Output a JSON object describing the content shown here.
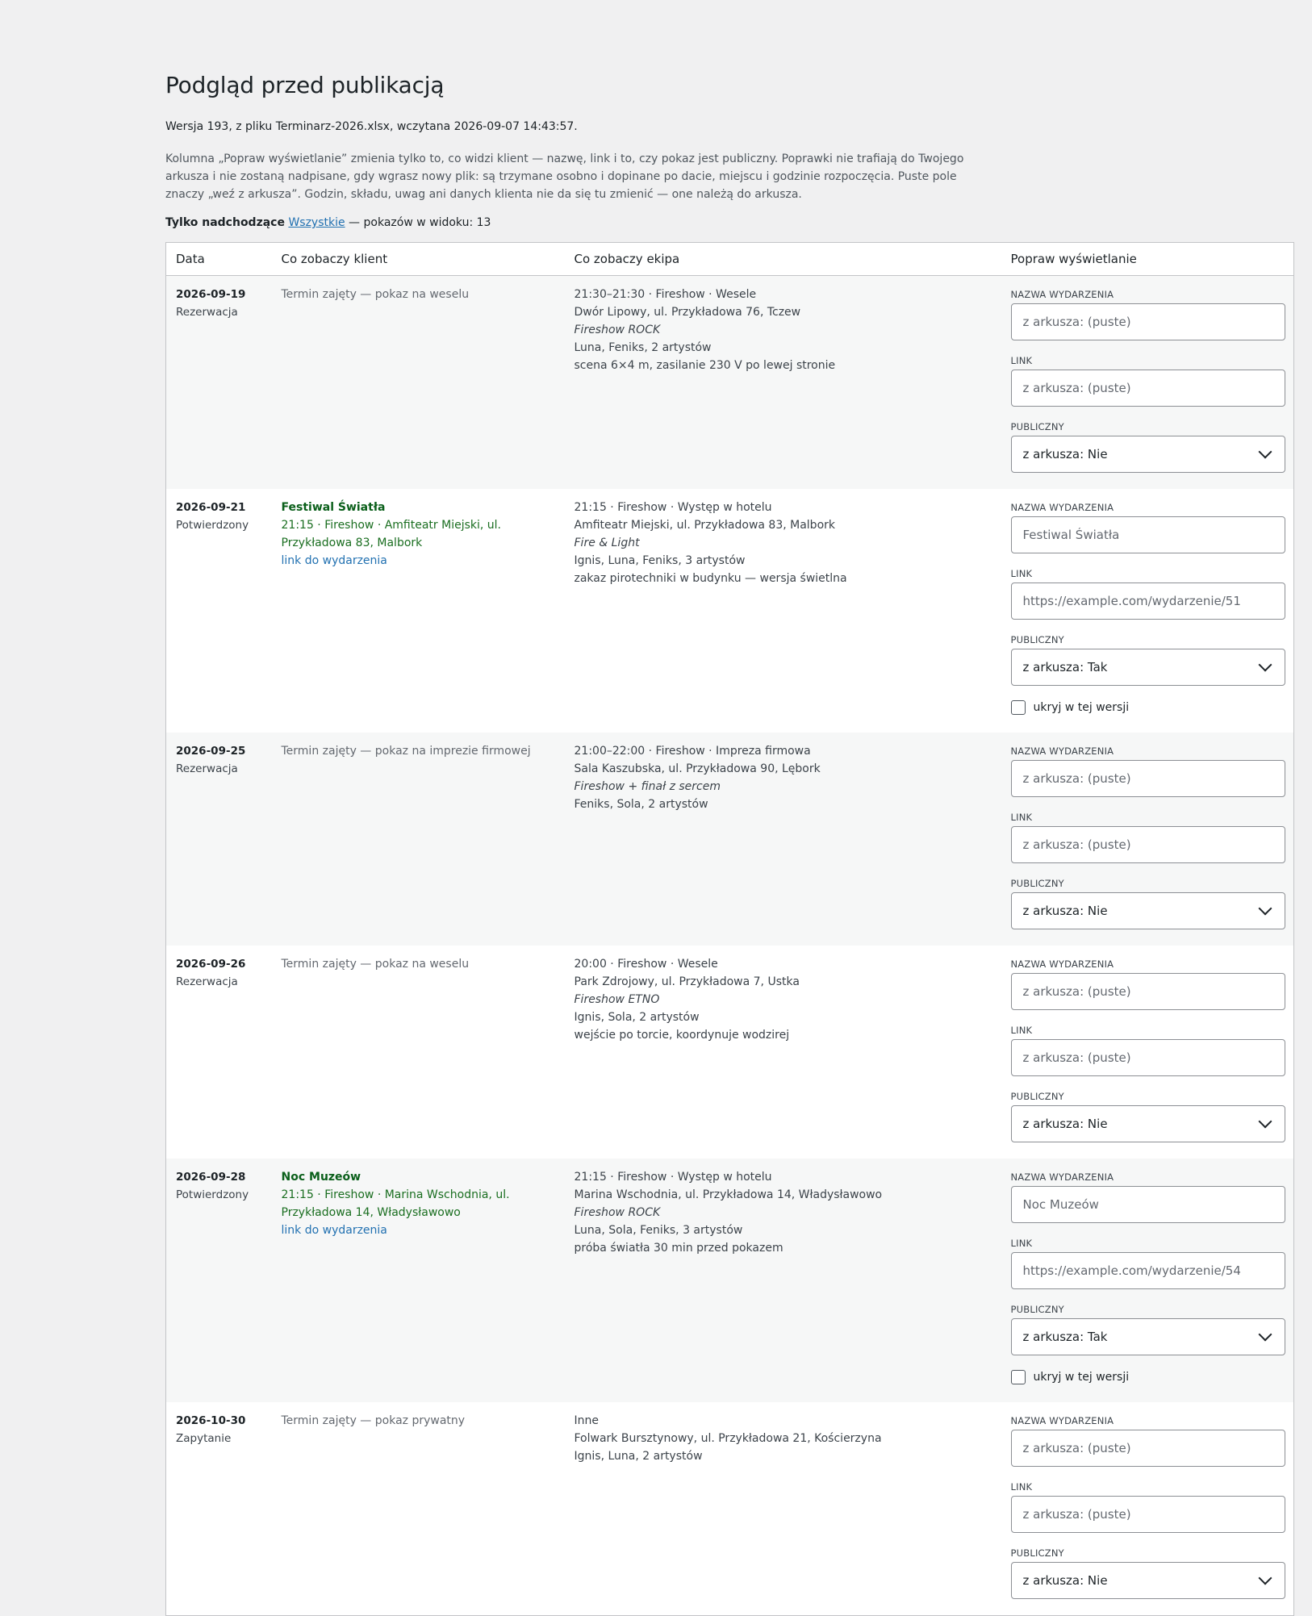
{
  "page": {
    "title": "Podgląd przed publikacją",
    "meta": "Wersja 193, z pliku Terminarz-2026.xlsx, wczytana 2026-09-07 14:43:57.",
    "description": "Kolumna „Popraw wyświetlanie” zmienia tylko to, co widzi klient — nazwę, link i to, czy pokaz jest publiczny. Poprawki nie trafiają do Twojego arkusza i nie zostaną nadpisane, gdy wgrasz nowy plik: są trzymane osobno i dopinane po dacie, miejscu i godzinie rozpoczęcia. Puste pole znaczy „weź z arkusza”. Godzin, składu, uwag ani danych klienta nie da się tu zmienić — one należą do arkusza."
  },
  "filter": {
    "current": "Tylko nadchodzące",
    "other": "Wszystkie",
    "suffix": " — pokazów w widoku: 13"
  },
  "table": {
    "headers": [
      "Data",
      "Co zobaczy klient",
      "Co zobaczy ekipa",
      "Popraw wyświetlanie"
    ],
    "labels": {
      "name": "NAZWA WYDARZENIA",
      "link": "LINK",
      "public": "PUBLICZNY",
      "hide": "ukryj w tej wersji"
    }
  },
  "rows": [
    {
      "date": "2026-09-19",
      "status": "Rezerwacja",
      "client_muted": "Termin zajęty — pokaz na weselu",
      "crew": [
        "21:30–21:30 · Fireshow · Wesele",
        "Dwór Lipowy, ul. Przykładowa 76, Tczew",
        "Fireshow ROCK",
        "Luna, Feniks, 2 artystów",
        "scena 6×4 m, zasilanie 230 V po lewej stronie"
      ],
      "name_ph": "z arkusza: (puste)",
      "link_ph": "z arkusza: (puste)",
      "public": "z arkusza: Nie"
    },
    {
      "date": "2026-09-21",
      "status": "Potwierdzony",
      "client_title": "Festiwal Światła",
      "client_line": "21:15 · Fireshow · Amfiteatr Miejski, ul. Przykładowa 83, Malbork",
      "client_link": "link do wydarzenia",
      "crew": [
        "21:15 · Fireshow · Występ w hotelu",
        "Amfiteatr Miejski, ul. Przykładowa 83, Malbork",
        "Fire & Light",
        "Ignis, Luna, Feniks, 3 artystów",
        "zakaz pirotechniki w budynku — wersja świetlna"
      ],
      "name_ph": "Festiwal Światła",
      "link_ph": "https://example.com/wydarzenie/51",
      "public": "z arkusza: Tak"
    },
    {
      "date": "2026-09-25",
      "status": "Rezerwacja",
      "client_muted": "Termin zajęty — pokaz na imprezie firmowej",
      "crew": [
        "21:00–22:00 · Fireshow · Impreza firmowa",
        "Sala Kaszubska, ul. Przykładowa 90, Lębork",
        "Fireshow + finał z sercem",
        "Feniks, Sola, 2 artystów"
      ],
      "name_ph": "z arkusza: (puste)",
      "link_ph": "z arkusza: (puste)",
      "public": "z arkusza: Nie"
    },
    {
      "date": "2026-09-26",
      "status": "Rezerwacja",
      "client_muted": "Termin zajęty — pokaz na weselu",
      "crew": [
        "20:00 · Fireshow · Wesele",
        "Park Zdrojowy, ul. Przykładowa 7, Ustka",
        "Fireshow ETNO",
        "Ignis, Sola, 2 artystów",
        "wejście po torcie, koordynuje wodzirej"
      ],
      "name_ph": "z arkusza: (puste)",
      "link_ph": "z arkusza: (puste)",
      "public": "z arkusza: Nie"
    },
    {
      "date": "2026-09-28",
      "status": "Potwierdzony",
      "client_title": "Noc Muzeów",
      "client_line": "21:15 · Fireshow · Marina Wschodnia, ul. Przykładowa 14, Władysławowo",
      "client_link": "link do wydarzenia",
      "crew": [
        "21:15 · Fireshow · Występ w hotelu",
        "Marina Wschodnia, ul. Przykładowa 14, Władysławowo",
        "Fireshow ROCK",
        "Luna, Sola, Feniks, 3 artystów",
        "próba światła 30 min przed pokazem"
      ],
      "name_ph": "Noc Muzeów",
      "link_ph": "https://example.com/wydarzenie/54",
      "public": "z arkusza: Tak"
    },
    {
      "date": "2026-10-30",
      "status": "Zapytanie",
      "client_muted": "Termin zajęty — pokaz prywatny",
      "crew": [
        "Inne",
        "Folwark Bursztynowy, ul. Przykładowa 21, Kościerzyna",
        "Ignis, Luna, 2 artystów"
      ],
      "name_ph": "z arkusza: (puste)",
      "link_ph": "z arkusza: (puste)",
      "public": "z arkusza: Nie"
    }
  ]
}
